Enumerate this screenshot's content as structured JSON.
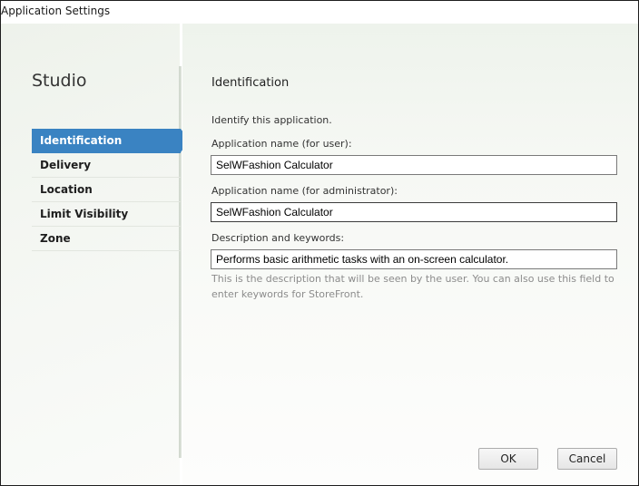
{
  "window": {
    "title": "Application Settings"
  },
  "sidebar": {
    "heading": "Studio",
    "items": [
      {
        "label": "Identification",
        "active": true
      },
      {
        "label": "Delivery",
        "active": false
      },
      {
        "label": "Location",
        "active": false
      },
      {
        "label": "Limit Visibility",
        "active": false
      },
      {
        "label": "Zone",
        "active": false
      }
    ]
  },
  "main": {
    "section_title": "Identification",
    "intro": "Identify this application.",
    "user_name_label": "Application name (for user):",
    "user_name_value": "SelWFashion Calculator",
    "admin_name_label": "Application name (for administrator):",
    "admin_name_value": "SelWFashion Calculator",
    "description_label": "Description and keywords:",
    "description_value": "Performs basic arithmetic tasks with an on-screen calculator.",
    "hint": "This is the description that will be seen by the user. You can also use this field to enter keywords for StoreFront."
  },
  "buttons": {
    "ok": "OK",
    "cancel": "Cancel"
  },
  "colors": {
    "accent": "#3a83c2",
    "hint_text": "#8c8c8c"
  }
}
